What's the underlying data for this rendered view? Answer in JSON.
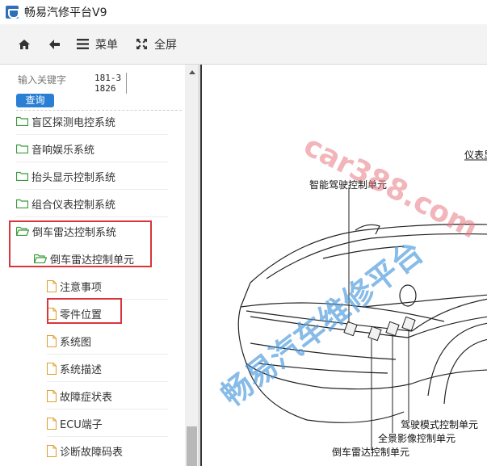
{
  "app": {
    "title": "畅易汽修平台V9"
  },
  "toolbar": {
    "home_icon": "home-icon",
    "back_icon": "arrow-left-icon",
    "menu_label": "菜单",
    "fullscreen_label": "全屏"
  },
  "search": {
    "placeholder": "输入关键字",
    "button_label": "查询",
    "code": "181-31826"
  },
  "tree": {
    "items": [
      {
        "label": "盲区探测电控系统",
        "type": "folder"
      },
      {
        "label": "音响娱乐系统",
        "type": "folder"
      },
      {
        "label": "抬头显示控制系统",
        "type": "folder"
      },
      {
        "label": "组合仪表控制系统",
        "type": "folder"
      },
      {
        "label": "倒车雷达控制系统",
        "type": "folder-open"
      },
      {
        "label": "倒车雷达控制单元",
        "type": "folder-open"
      },
      {
        "label": "注意事项",
        "type": "document"
      },
      {
        "label": "零件位置",
        "type": "document"
      },
      {
        "label": "系统图",
        "type": "document"
      },
      {
        "label": "系统描述",
        "type": "document"
      },
      {
        "label": "故障症状表",
        "type": "document"
      },
      {
        "label": "ECU端子",
        "type": "document"
      },
      {
        "label": "诊断故障码表",
        "type": "document"
      }
    ]
  },
  "diagram": {
    "labels": {
      "instrument": "仪表显",
      "adas": "智能驾驶控制单元",
      "drive_mode": "驾驶模式控制单元",
      "panorama": "全景影像控制单元",
      "radar": "倒车雷达控制单元"
    },
    "watermark_url": "car388.com",
    "watermark_cn": "畅易汽车维修平台"
  },
  "colors": {
    "highlight_border": "#d9353a",
    "search_button": "#2a7fd4",
    "folder_icon": "#3a9a3a",
    "document_icon": "#e0a030"
  }
}
